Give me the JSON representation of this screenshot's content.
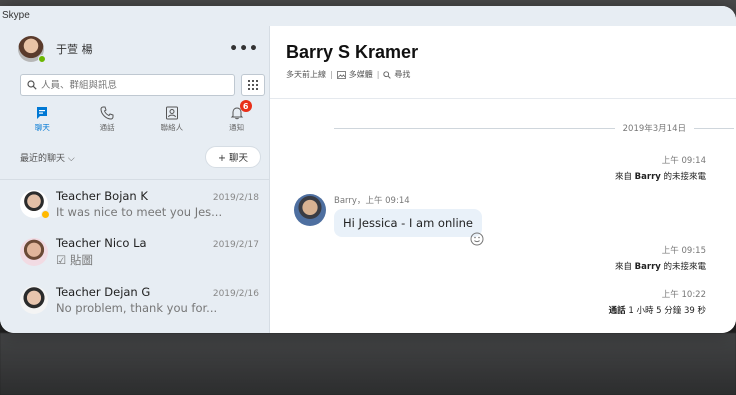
{
  "window": {
    "title": "Skype"
  },
  "profile": {
    "name": "于萱 楊",
    "more": "•••"
  },
  "search": {
    "placeholder": "人員、群組與訊息"
  },
  "nav": [
    {
      "label": "聊天",
      "icon": "chat-icon",
      "active": true
    },
    {
      "label": "通話",
      "icon": "phone-icon"
    },
    {
      "label": "聯絡人",
      "icon": "contacts-icon"
    },
    {
      "label": "通知",
      "icon": "bell-icon",
      "badge": "6"
    }
  ],
  "recent": {
    "label": "最近的聊天 ⌵",
    "new_chat": "+ 聊天"
  },
  "contacts": [
    {
      "name": "Teacher Bojan K",
      "date": "2019/2/18",
      "preview": "It was nice to meet you Jes..."
    },
    {
      "name": "Teacher Nico La",
      "date": "2019/2/17",
      "preview": "☑ 貼圖"
    },
    {
      "name": "Teacher Dejan G",
      "date": "2019/2/16",
      "preview": "No problem, thank you for..."
    }
  ],
  "conversation": {
    "title": "Barry S Kramer",
    "last_seen": "多天前上線",
    "media_label": "多媒體",
    "find_label": "尋找",
    "date_separator": "2019年3月14日",
    "events": [
      {
        "time": "上午 09:14",
        "desc_prefix": "來自 ",
        "desc_bold": "Barry",
        "desc_suffix": " 的未接來電"
      },
      {
        "time": "上午 09:15",
        "desc_prefix": "來自 ",
        "desc_bold": "Barry",
        "desc_suffix": " 的未接來電"
      },
      {
        "time": "上午 10:22",
        "desc_prefix": "",
        "desc_bold": "通話",
        "desc_suffix": " 1 小時 5 分鐘 39 秒"
      }
    ],
    "message": {
      "sender": "Barry",
      "time": "上午 09:14",
      "meta_sep": "，",
      "text": "Hi Jessica - I am online"
    }
  },
  "colors": {
    "accent": "#0078d4",
    "sidebar_bg": "#e7edf3",
    "bubble_bg": "#e9f1f9",
    "online": "#6bb700",
    "away": "#ffb900",
    "badge": "#e8301a"
  }
}
